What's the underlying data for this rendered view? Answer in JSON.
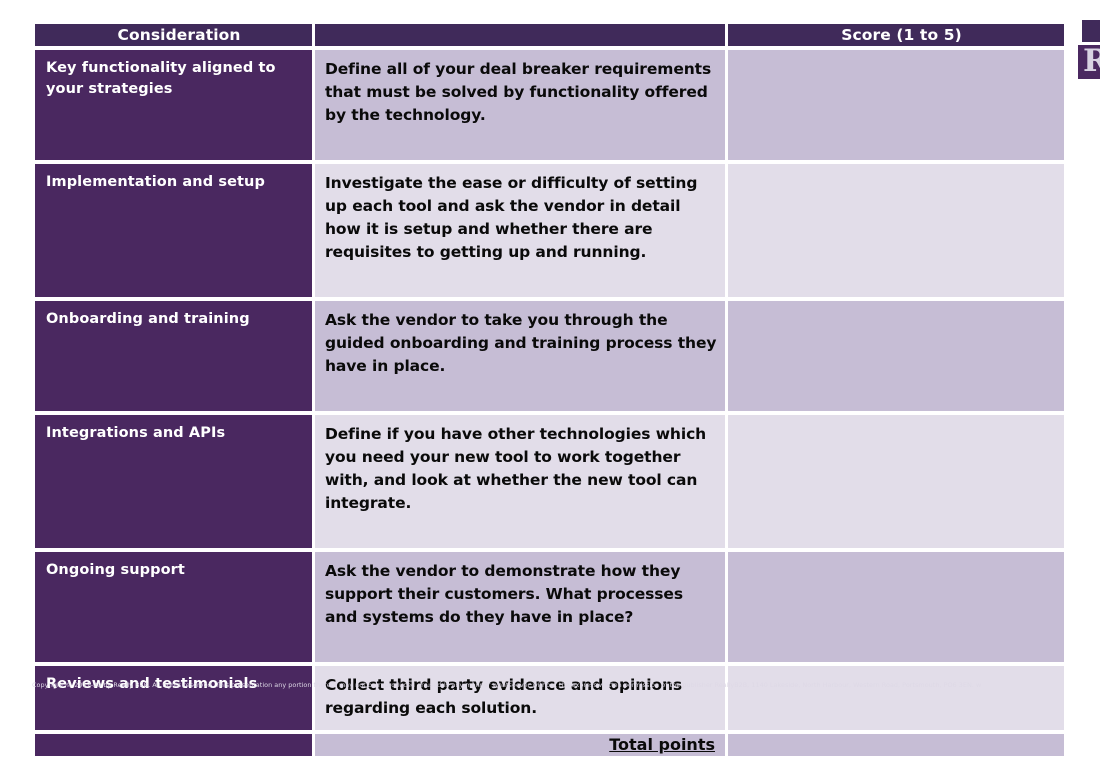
{
  "table": {
    "headers": {
      "consideration": "Consideration",
      "description": "",
      "score": "Score (1 to 5)"
    },
    "rows": [
      {
        "consideration": "Key functionality aligned to your strategies",
        "description": "Define all of your deal breaker requirements that must be solved by functionality offered by the technology.",
        "score": ""
      },
      {
        "consideration": "Implementation and setup",
        "description": "Investigate the ease or difficulty of setting up each tool and ask the vendor in detail how it is setup and whether there are requisites to getting up and running.",
        "score": ""
      },
      {
        "consideration": "Onboarding and training",
        "description": "Ask the vendor to take you through the guided onboarding and training process they have in place.",
        "score": ""
      },
      {
        "consideration": "Integrations and APIs",
        "description": "Define if you have other technologies which you need your new tool to work together with, and look at whether the new tool can integrate.",
        "score": ""
      },
      {
        "consideration": "Ongoing support",
        "description": "Ask the vendor to demonstrate how they support their customers. What processes and systems do they have in place?",
        "score": ""
      },
      {
        "consideration": "Reviews and testimonials",
        "description": "Collect third party evidence and opinions regarding each solution.",
        "score": ""
      }
    ],
    "total_row": {
      "label": "Total points",
      "value": ""
    }
  },
  "logo": {
    "glyph": "R"
  },
  "footer": {
    "copyright": "Copyright © 2017-20 by Really B2B. All rights reserved. This presentation any portion thereof may not be reproduced or used in any manner whatsoever without the express written permission of the publisher ReallyB2B, 1140 Lakeside, North Harbour, Western Road, Portsmouth, PO6 3EN. w"
  },
  "colors": {
    "header_purple": "#402a5a",
    "cell_purple": "#4a2860",
    "shade_dark": "#c6bdd5",
    "shade_light": "#e2dde9",
    "text_dark": "#0a0a0a",
    "text_light": "#ffffff"
  }
}
